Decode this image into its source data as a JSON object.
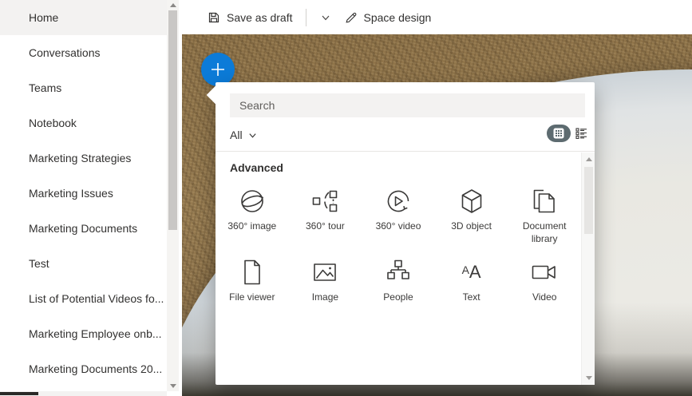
{
  "sidebar": {
    "items": [
      {
        "label": "Home"
      },
      {
        "label": "Conversations"
      },
      {
        "label": "Teams"
      },
      {
        "label": "Notebook"
      },
      {
        "label": "Marketing Strategies"
      },
      {
        "label": "Marketing Issues"
      },
      {
        "label": "Marketing Documents"
      },
      {
        "label": "Test"
      },
      {
        "label": "List of Potential Videos fo..."
      },
      {
        "label": "Marketing Employee onb..."
      },
      {
        "label": "Marketing Documents 20..."
      }
    ]
  },
  "toolbar": {
    "save_label": "Save as draft",
    "design_label": "Space design"
  },
  "panel": {
    "search_placeholder": "Search",
    "filter_label": "All",
    "section_title": "Advanced",
    "text_icon": {
      "first": "A",
      "second": "A"
    },
    "tiles": [
      {
        "label": "360° image",
        "icon": "sphere-360-icon"
      },
      {
        "label": "360° tour",
        "icon": "tour-360-icon"
      },
      {
        "label": "360° video",
        "icon": "video-360-icon"
      },
      {
        "label": "3D object",
        "icon": "cube-3d-icon"
      },
      {
        "label": "Document library",
        "icon": "document-library-icon"
      },
      {
        "label": "File viewer",
        "icon": "file-viewer-icon"
      },
      {
        "label": "Image",
        "icon": "image-icon"
      },
      {
        "label": "People",
        "icon": "org-chart-icon"
      },
      {
        "label": "Text",
        "icon": "text-icon"
      },
      {
        "label": "Video",
        "icon": "video-camera-icon"
      }
    ]
  },
  "colors": {
    "accent": "#0c7bd8",
    "toggle_pill": "#5d6b70",
    "text_primary": "#323130"
  }
}
